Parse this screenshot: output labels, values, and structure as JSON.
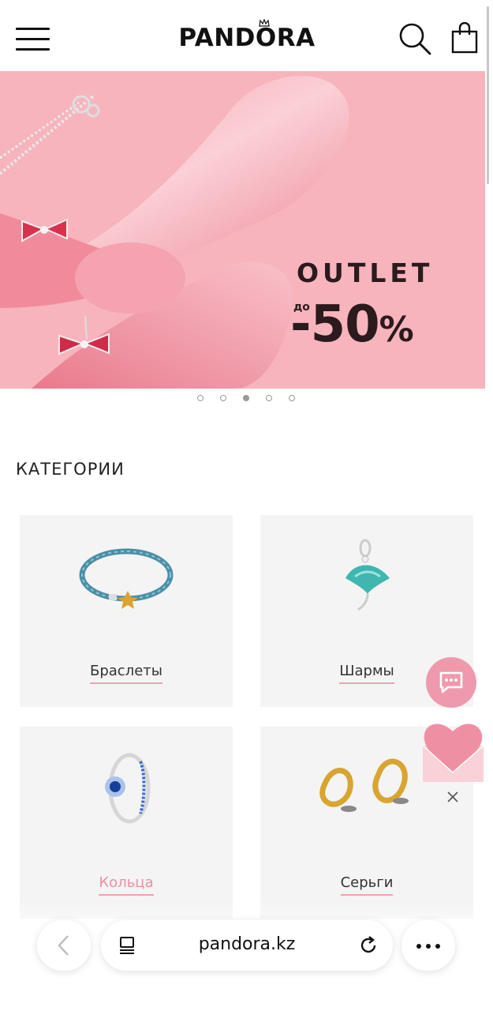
{
  "header": {
    "logo_text": "PANDORA",
    "menu_icon": "hamburger-menu-icon",
    "search_icon": "search-icon",
    "bag_icon": "shopping-bag-icon"
  },
  "hero": {
    "headline": "OUTLET",
    "prefix": "до",
    "discount": "-50",
    "percent": "%",
    "background_color": "#f7b4bd",
    "slides": 5,
    "active_slide": 3
  },
  "categories": {
    "title": "КАТЕГОРИИ",
    "items": [
      {
        "label": "Браслеты",
        "icon": "bracelet-icon"
      },
      {
        "label": "Шармы",
        "icon": "charm-icon"
      },
      {
        "label": "Кольца",
        "icon": "ring-icon",
        "highlighted": true
      },
      {
        "label": "Серьги",
        "icon": "earrings-icon"
      }
    ]
  },
  "widgets": {
    "chat_icon": "chat-bubble-icon",
    "heart_icon": "heart-icon",
    "close_icon": "close-icon",
    "accent_color": "#ef9aac"
  },
  "browser": {
    "url": "pandora.kz",
    "back_icon": "chevron-left-icon",
    "tabs_icon": "tabs-icon",
    "reload_icon": "reload-icon",
    "more_icon": "more-icon"
  }
}
